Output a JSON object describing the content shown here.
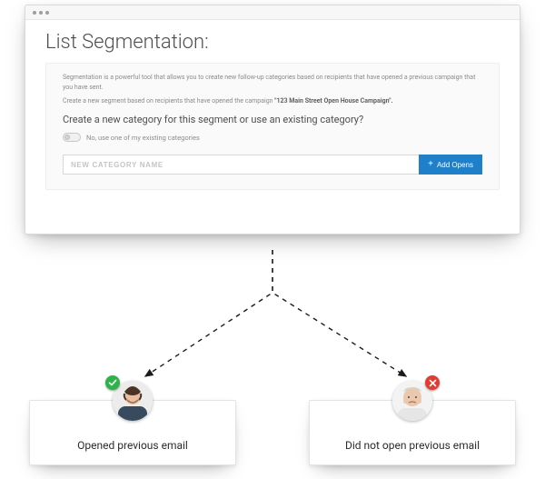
{
  "window": {
    "title": "List Segmentation:",
    "help_line_1": "Segmentation is a powerful tool that allows you to create new follow-up categories based on recipients that have opened a previous campaign that you have sent.",
    "help_line_2_prefix": "Create a new segment based on recipients that have opened the campaign ",
    "campaign_name": "\"123 Main Street Open House Campaign\".",
    "question": "Create a new category for this segment or use an existing category?",
    "toggle_label": "No, use one of my existing categories",
    "input_placeholder": "NEW CATEGORY NAME",
    "add_button": "Add Opens"
  },
  "outcomes": {
    "opened": {
      "label": "Opened previous email"
    },
    "not_opened": {
      "label": "Did not open previous email"
    }
  },
  "colors": {
    "primary_button": "#1f7fc9",
    "success_badge": "#2fb24c",
    "error_badge": "#e23b32"
  }
}
